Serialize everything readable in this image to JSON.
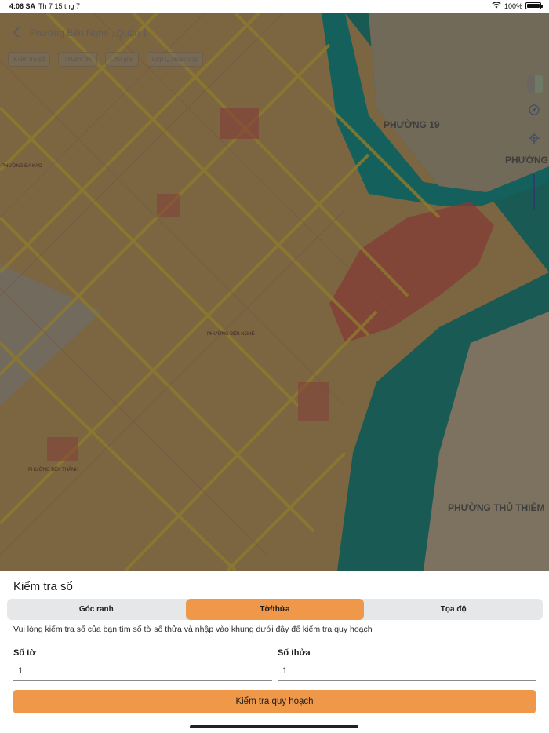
{
  "status_bar": {
    "time": "4:06 SA",
    "date": "Th 7 15 thg 7",
    "battery": "100%"
  },
  "map": {
    "title": "Phường Bến Nghé , Quận 1",
    "chips": [
      "Kiểm tra sổ",
      "Thước đo",
      "Chú giải",
      "Lớp Q.Hoạch(3)"
    ],
    "labels": {
      "phuong_19": "PHƯỜNG 19",
      "phuong_ng": "PHƯỜNG",
      "phuong_thu_thiem": "PHƯỜNG THỦ THIÊM",
      "phuong_ben_nghe": "PHƯỜNG BẾN NGHÉ",
      "phuong_ben_thanh": "PHƯỜNG BẾN THÀNH",
      "phuong_da_kao": "PHƯỜNG ĐA KAO"
    },
    "colors": {
      "land": "#c9a36a",
      "river": "#1a8f8c",
      "roads": "#e2c34a",
      "dim_overlay": "rgba(0,0,0,0.38)"
    }
  },
  "sheet": {
    "title": "Kiểm tra sổ",
    "tabs": [
      {
        "label": "Góc ranh",
        "active": false
      },
      {
        "label": "Tờ/thửa",
        "active": true
      },
      {
        "label": "Tọa độ",
        "active": false
      }
    ],
    "instruction": "Vui lòng kiểm tra số của bạn tìm số tờ số thửa và nhập vào khung dưới đây để kiểm tra quy hoạch",
    "so_to_label": "Số tờ",
    "so_to_value": "1",
    "so_thua_label": "Số thửa",
    "so_thua_value": "1",
    "submit_label": "Kiểm tra quy hoạch",
    "accent": "#f0984a"
  }
}
